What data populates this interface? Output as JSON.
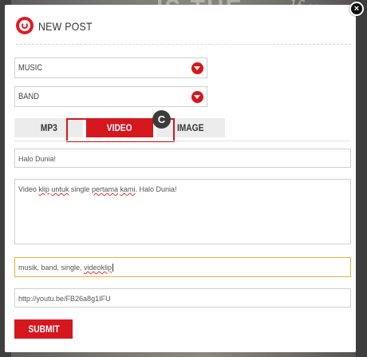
{
  "background": {
    "big_text": "IS THE",
    "script_text": "~lf u"
  },
  "modal": {
    "title": "NEW POST",
    "close_glyph": "×"
  },
  "selects": {
    "category": "MUSIC",
    "subcategory": "BAND"
  },
  "tabs": [
    {
      "label": "MP3",
      "active": false
    },
    {
      "label": "VIDEO",
      "active": true
    },
    {
      "label": "IMAGE",
      "active": false
    }
  ],
  "annotation_badge": "C",
  "fields": {
    "title_value": "Halo Dunia!",
    "body_value_prefix": "Video ",
    "body_value_word1": "klip",
    "body_value_mid": " ",
    "body_value_word2": "untuk",
    "body_value_mid2": " single ",
    "body_value_word3": "pertama",
    "body_value_mid3": " ",
    "body_value_word4": "kami",
    "body_value_suffix": ". Halo Dunia!",
    "tags_value": "musik, band, single, ",
    "tags_value_underlined": "videoklip",
    "url_value": "http://youtu.be/FB26a8g1IFU"
  },
  "submit_label": "SUBMIT",
  "colors": {
    "accent": "#d6171e",
    "focus_border": "#e6b23c"
  }
}
